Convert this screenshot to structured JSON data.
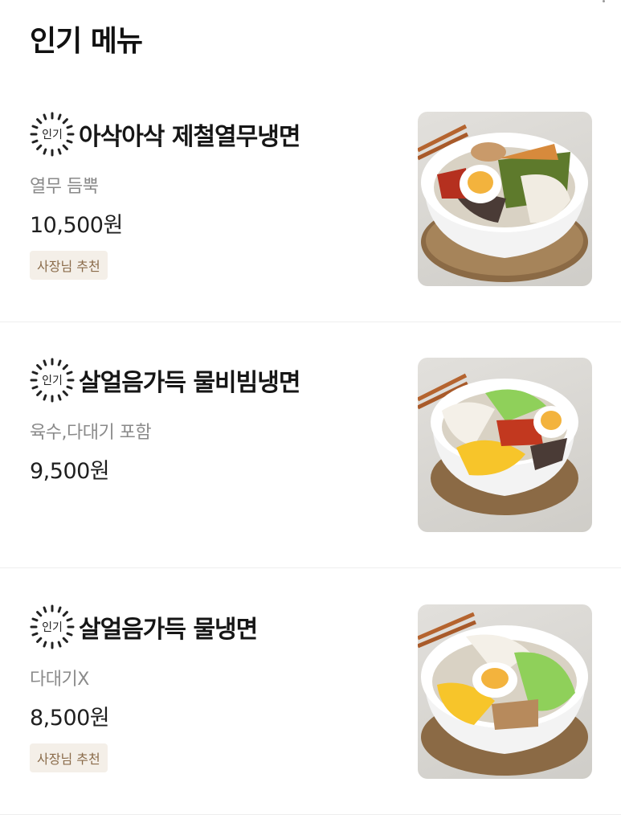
{
  "section": {
    "title": "인기 메뉴"
  },
  "badge": {
    "text": "인기"
  },
  "items": [
    {
      "name": "아삭아삭 제철열무냉면",
      "description": "열무 듬뿍",
      "price": "10,500원",
      "tag": "사장님 추천",
      "image": "bibim-naengmyeon-with-yeolmu-photo"
    },
    {
      "name": "살얼음가득 물비빔냉면",
      "description": "육수,다대기 포함",
      "price": "9,500원",
      "tag": "",
      "image": "mul-bibim-naengmyeon-photo"
    },
    {
      "name": "살얼음가득 물냉면",
      "description": "다대기X",
      "price": "8,500원",
      "tag": "사장님 추천",
      "image": "mul-naengmyeon-photo"
    }
  ],
  "colors": {
    "tag_bg": "#f4efe8",
    "tag_text": "#8a6b4a",
    "desc": "#8a8a8a"
  }
}
